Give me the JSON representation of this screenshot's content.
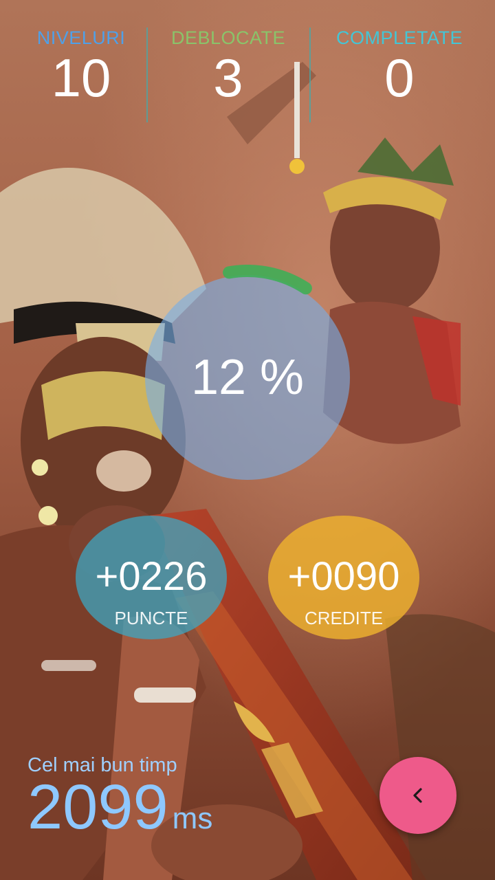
{
  "stats": {
    "levels_label": "NIVELURI",
    "levels_value": "10",
    "unlocked_label": "DEBLOCATE",
    "unlocked_value": "3",
    "completed_label": "COMPLETATE",
    "completed_value": "0"
  },
  "progress": {
    "text": "12 %",
    "fraction": 0.12
  },
  "rewards": {
    "points_value": "+0226",
    "points_label": "PUNCTE",
    "credits_value": "+0090",
    "credits_label": "CREDITE"
  },
  "best_time": {
    "label": "Cel mai bun timp",
    "value": "2099",
    "unit": "ms"
  },
  "back_button": {
    "icon": "chevron-left-icon"
  },
  "colors": {
    "levels_label": "#4fa0e8",
    "unlocked_label": "#8ac46a",
    "completed_label": "#42c6d6",
    "progress_arc": "#3fae56",
    "points_circle": "#3aa9c6",
    "credits_circle": "#f0b42e",
    "back_button": "#ee5a8a"
  }
}
